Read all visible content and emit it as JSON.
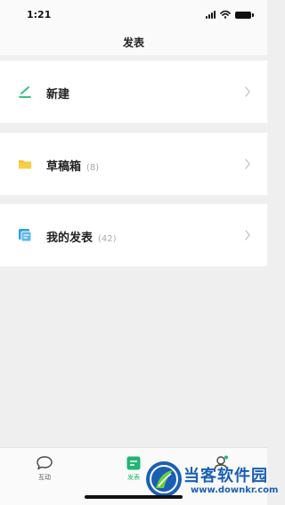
{
  "status_bar": {
    "time": "1:21"
  },
  "header": {
    "title": "发表"
  },
  "menu": [
    {
      "label": "新建",
      "count": "",
      "icon": "pencil-icon",
      "color": "#22b573"
    },
    {
      "label": "草稿箱",
      "count": "(8)",
      "icon": "folder-icon",
      "color": "#f5c22b"
    },
    {
      "label": "我的发表",
      "count": "(42)",
      "icon": "published-icon",
      "color": "#2b9fe0"
    }
  ],
  "tab_bar": {
    "tabs": [
      {
        "label": "互动",
        "icon": "chat-bubble-icon",
        "active": false
      },
      {
        "label": "发表",
        "icon": "post-icon",
        "active": true
      },
      {
        "label": "",
        "icon": "profile-icon",
        "active": false
      }
    ]
  },
  "watermark": {
    "name": "当客软件园",
    "url": "www.downkr.com"
  },
  "colors": {
    "accent": "#22b573",
    "background": "#efefef",
    "card": "#ffffff",
    "watermark": "#1a5fb4"
  }
}
